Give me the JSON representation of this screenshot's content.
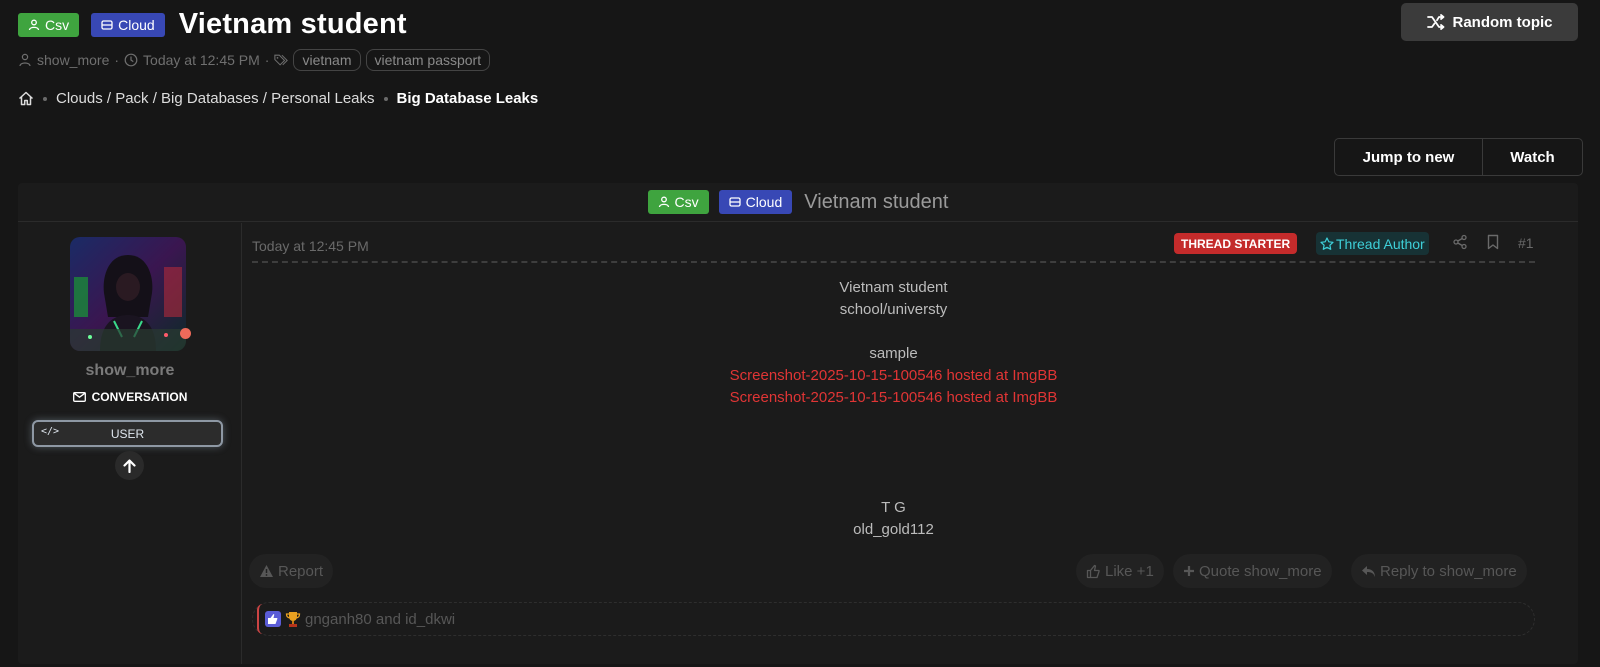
{
  "thread": {
    "prefixes": [
      "Csv",
      "Cloud"
    ],
    "title": "Vietnam student",
    "author": "show_more",
    "separator": "·",
    "date": "Today at 12:45 PM",
    "tags": [
      "vietnam",
      "vietnam passport"
    ]
  },
  "header": {
    "random_topic_label": "Random topic"
  },
  "breadcrumb": {
    "path_label": "Clouds / Pack / Big Databases / Personal Leaks",
    "current": "Big Database Leaks"
  },
  "toolbar": {
    "jump_label": "Jump to new",
    "watch_label": "Watch"
  },
  "post": {
    "username": "show_more",
    "conversation_label": "CONVERSATION",
    "role_label": "USER",
    "role_code": "</>",
    "time": "Today at 12:45 PM",
    "starter_badge": "THREAD STARTER",
    "author_badge": "Thread Author",
    "number": "#1",
    "body": {
      "line1": "Vietnam student",
      "line2": "school/universty",
      "line3": "sample",
      "link1": "Screenshot-2025-10-15-100546 hosted at ImgBB",
      "link2": "Screenshot-2025-10-15-100546 hosted at ImgBB",
      "sig1": "T G",
      "sig2": "old_gold112"
    },
    "actions": {
      "report": "Report",
      "like": "Like +1",
      "quote": "Quote show_more",
      "reply": "Reply to show_more"
    },
    "reactions_text": "gnganh80 and id_dkwi"
  },
  "colors": {
    "csv_prefix": "#3fa43f",
    "cloud_prefix": "#3848b5",
    "starter": "#c42b2b",
    "author": "#3ecfd8",
    "link": "#e03535"
  }
}
